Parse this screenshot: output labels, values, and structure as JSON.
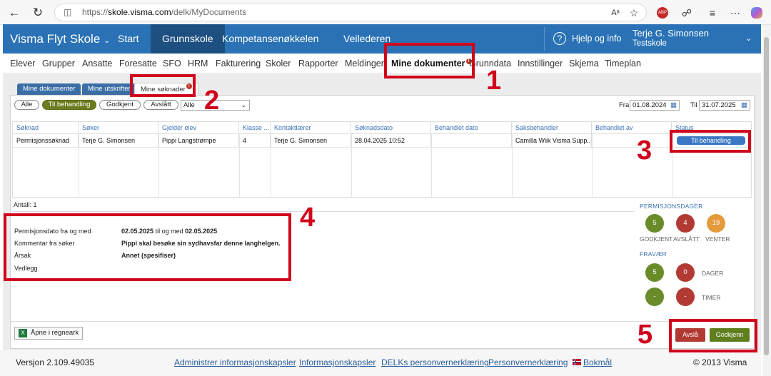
{
  "browser": {
    "url_prefix": "https://",
    "url_host": "skole.visma.com",
    "url_path": "/delk/MyDocuments",
    "reader_icon": "Aᵃ"
  },
  "app": {
    "title": "Visma Flyt Skole",
    "nav": [
      "Start",
      "Grunnskole",
      "Kompetansenøkkelen",
      "Veilederen"
    ],
    "help": "Hjelp og info",
    "user_name": "Terje G. Simonsen",
    "user_school": "Testskole"
  },
  "subnav": [
    "Elever",
    "Grupper",
    "Ansatte",
    "Foresatte",
    "SFO",
    "HRM",
    "Fakturering",
    "Skoler",
    "Rapporter",
    "Meldinger",
    "Mine dokumenter",
    "Grunndata",
    "Innstillinger",
    "Skjema",
    "Timeplan"
  ],
  "badge": "!",
  "tabs": [
    "Mine dokumenter",
    "Mine utskrifter",
    "Mine søknader"
  ],
  "filters": {
    "buttons": [
      "Alle",
      "Til behandling",
      "Godkjent",
      "Avslått"
    ],
    "select": "Alle",
    "from_label": "Fra",
    "from": "01.08.2024",
    "to_label": "Til",
    "to": "31.07.2025"
  },
  "table": {
    "headers": [
      "Søknad",
      "Søker",
      "Gjelder elev",
      "Klasse ...",
      "Kontaktlærer",
      "Søknadsdato",
      "Behandlet dato",
      "Saksbehandler",
      "Behandlet av",
      "Status"
    ],
    "row": [
      "Permisjonssøknad",
      "Terje G. Simonsen",
      "Pippi Langstrømpe",
      "4",
      "Terje G. Simonsen",
      "28.04.2025 10:52",
      "",
      "Camilla Wiik Visma Supp...",
      "",
      "Til behandling"
    ]
  },
  "count": "Antall: 1",
  "details": {
    "labels": [
      "Permisjonsdato fra og med",
      "Kommentar fra søker",
      "Årsak",
      "Vedlegg"
    ],
    "date_from": "02.05.2025",
    "til_og_med": "til og med",
    "date_to": "02.05.2025",
    "comment": "Pippi skal besøke sin sydhavsfar denne langhelgen.",
    "reason": "Annet (spesifiser)"
  },
  "stats": {
    "perm_title": "PERMISJONSDAGER",
    "godkjent": "5",
    "avslatt": "4",
    "venter": "19",
    "godkjent_lbl": "GODKJENT",
    "avslatt_lbl": "AVSLÅTT",
    "venter_lbl": "VENTER",
    "fravar_title": "FRAVÆR",
    "dager": "0",
    "dager_green": "5",
    "dager_lbl": "DAGER",
    "timer_green": "-",
    "timer_red": "-",
    "timer_lbl": "TIMER",
    "colors": {
      "green": "#6a8b2a",
      "red": "#b23a33",
      "orange": "#e59a3c"
    }
  },
  "excel": "Åpne i regneark",
  "actions": {
    "reject": "Avslå",
    "approve": "Godkjenn"
  },
  "footer": {
    "version": "Versjon 2.109.49035",
    "links": [
      "Administrer informasjonskapsler",
      "Informasjonskapsler",
      "DELKs personvernerklæring",
      "Personvernerklæring",
      "Bokmål"
    ],
    "copyright": "© 2013 Visma"
  },
  "annotations": [
    "1",
    "2",
    "3",
    "4",
    "5"
  ]
}
